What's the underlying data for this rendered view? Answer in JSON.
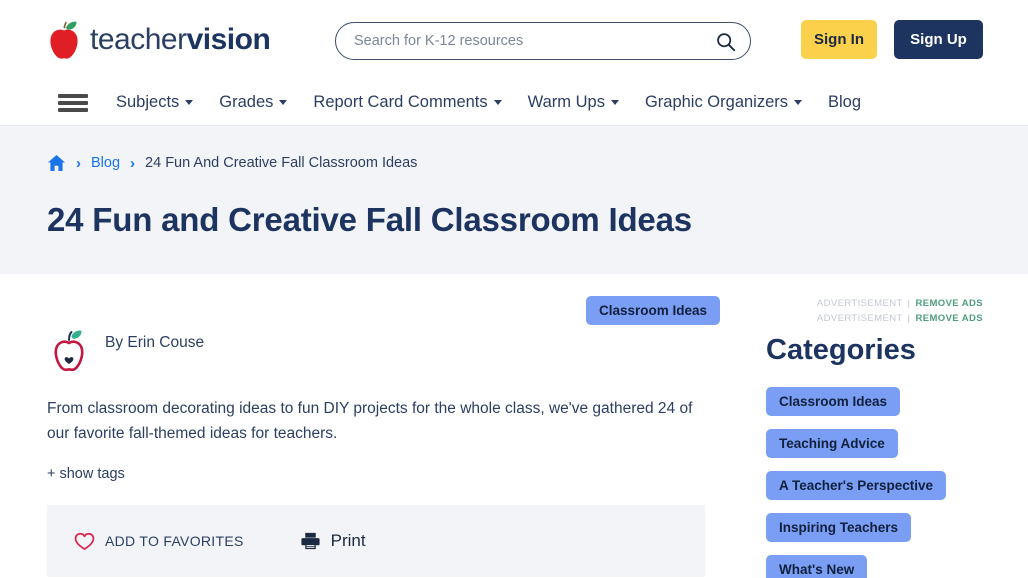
{
  "header": {
    "logo": {
      "text_light": "teacher",
      "text_bold": "vision",
      "icon": "apple-icon"
    },
    "search": {
      "placeholder": "Search for K-12 resources",
      "value": "",
      "icon": "search-icon"
    },
    "sign_in_label": "Sign In",
    "sign_up_label": "Sign Up",
    "colors": {
      "sign_in_bg": "#fbd04b",
      "sign_up_bg": "#1d3461",
      "logo_navy": "#1d3461"
    }
  },
  "nav": {
    "menu_icon": "hamburger-icon",
    "items": [
      {
        "label": "Subjects",
        "has_dropdown": true
      },
      {
        "label": "Grades",
        "has_dropdown": true
      },
      {
        "label": "Report Card Comments",
        "has_dropdown": true
      },
      {
        "label": "Warm Ups",
        "has_dropdown": true
      },
      {
        "label": "Graphic Organizers",
        "has_dropdown": true
      },
      {
        "label": "Blog",
        "has_dropdown": false
      }
    ]
  },
  "breadcrumb": {
    "home_icon": "home-icon",
    "separator": "›",
    "link_label": "Blog",
    "current_label": "24 Fun And Creative Fall Classroom Ideas"
  },
  "page": {
    "title": "24 Fun and Creative Fall Classroom Ideas",
    "topic_badge": "Classroom Ideas",
    "author_prefix": "By Erin Couse",
    "author_avatar_icon": "apple-heart-avatar-icon",
    "description": "From classroom decorating ideas to fun DIY projects for the whole class, we've gathered 24 of our favorite fall-themed ideas for teachers.",
    "show_tags_label": "+ show tags"
  },
  "actions": {
    "favorites_label": "ADD TO FAVORITES",
    "favorites_icon": "heart-outline-icon",
    "print_label": "Print",
    "print_icon": "printer-icon"
  },
  "sidebar": {
    "ads": [
      {
        "label": "ADVERTISEMENT",
        "pipe": "|",
        "remove_label": "REMOVE ADS"
      },
      {
        "label": "ADVERTISEMENT",
        "pipe": "|",
        "remove_label": "REMOVE ADS"
      }
    ],
    "categories_heading": "Categories",
    "categories": [
      {
        "label": "Classroom Ideas"
      },
      {
        "label": "Teaching Advice"
      },
      {
        "label": "A Teacher's Perspective"
      },
      {
        "label": "Inspiring Teachers"
      },
      {
        "label": "What's New"
      }
    ],
    "tag_color": "#7a9ef4",
    "remove_ads_color": "#4e9e7e"
  }
}
